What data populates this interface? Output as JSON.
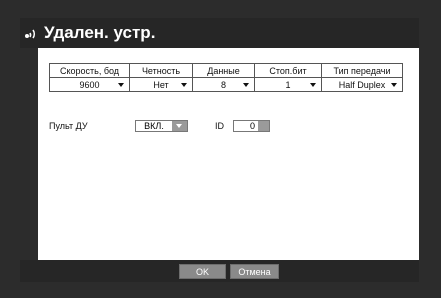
{
  "window": {
    "title": "Удален. устр."
  },
  "table": {
    "headers": [
      "Скорость, бод",
      "Четность",
      "Данные",
      "Стоп.бит",
      "Тип передачи"
    ],
    "values": [
      "9600",
      "Нет",
      "8",
      "1",
      "Half Duplex"
    ]
  },
  "remote": {
    "label": "Пульт ДУ",
    "value": "ВКЛ."
  },
  "id": {
    "label": "ID",
    "value": "0"
  },
  "footer": {
    "ok_label": "OK",
    "cancel_label": "Отмена"
  },
  "colors": {
    "background": "#2c2c2c",
    "panel": "#ffffff",
    "button": "#8a8a8a"
  }
}
